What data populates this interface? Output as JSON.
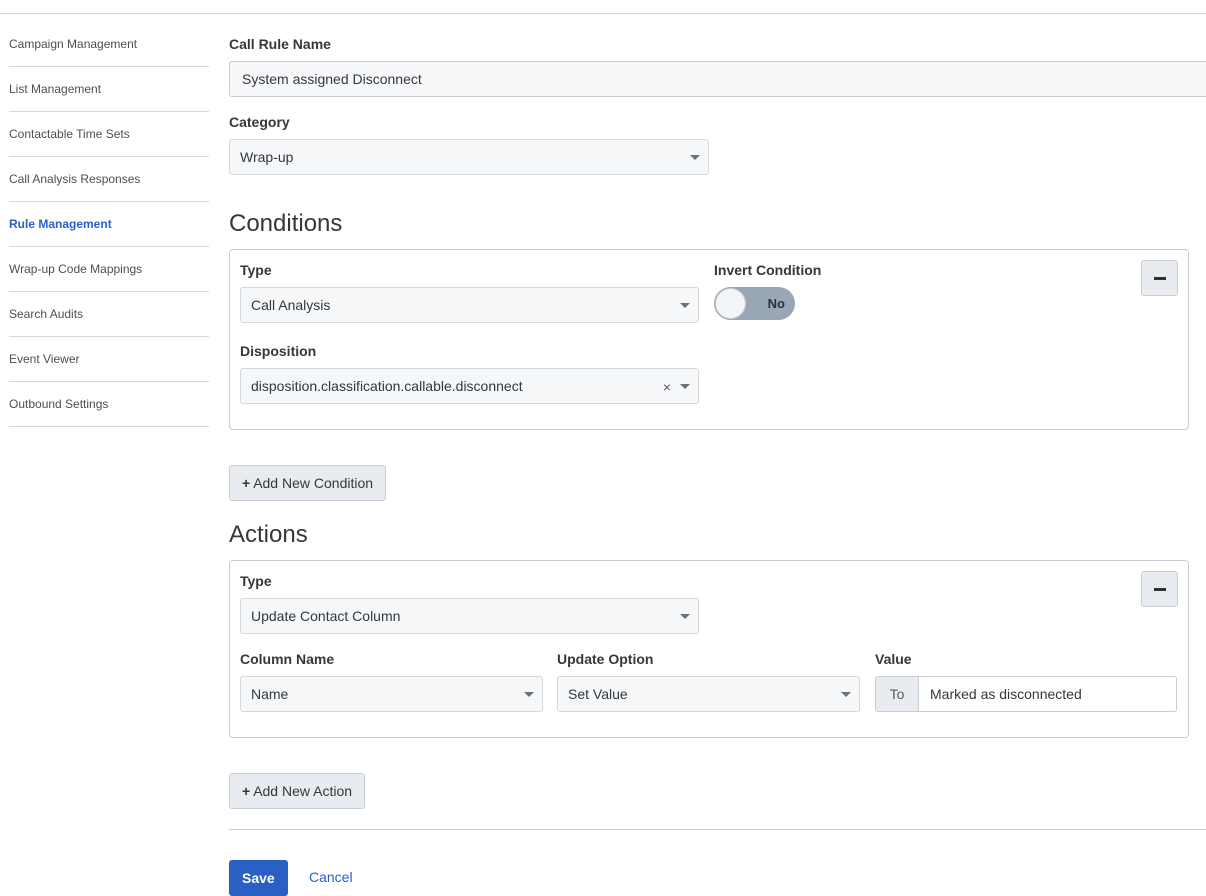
{
  "sidebar": {
    "items": [
      {
        "label": "Campaign Management"
      },
      {
        "label": "List Management"
      },
      {
        "label": "Contactable Time Sets"
      },
      {
        "label": "Call Analysis Responses"
      },
      {
        "label": "Rule Management",
        "active": true
      },
      {
        "label": "Wrap-up Code Mappings"
      },
      {
        "label": "Search Audits"
      },
      {
        "label": "Event Viewer"
      },
      {
        "label": "Outbound Settings"
      }
    ]
  },
  "form": {
    "name_label": "Call Rule Name",
    "name_value": "System assigned Disconnect",
    "category_label": "Category",
    "category_value": "Wrap-up"
  },
  "conditions": {
    "title": "Conditions",
    "type_label": "Type",
    "type_value": "Call Analysis",
    "invert_label": "Invert Condition",
    "invert_value": "No",
    "disposition_label": "Disposition",
    "disposition_value": "disposition.classification.callable.disconnect",
    "clear_glyph": "×",
    "add_label": "Add New Condition"
  },
  "actions": {
    "title": "Actions",
    "type_label": "Type",
    "type_value": "Update Contact Column",
    "column_label": "Column Name",
    "column_value": "Name",
    "option_label": "Update Option",
    "option_value": "Set Value",
    "value_label": "Value",
    "value_prefix": "To",
    "value_value": "Marked as disconnected",
    "add_label": "Add New Action"
  },
  "footer": {
    "save_label": "Save",
    "cancel_label": "Cancel"
  },
  "icons": {
    "plus": "+",
    "remove": "minus-icon",
    "dropdown": "chevron-down-icon"
  },
  "colors": {
    "accent": "#2a60c8",
    "primary_button": "#2a5fc4",
    "toggle_off": "#98a6b5"
  }
}
